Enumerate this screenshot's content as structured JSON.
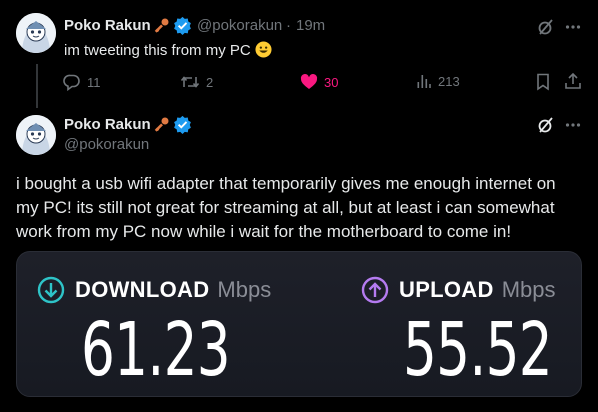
{
  "tweet1": {
    "name": "Poko Rakun",
    "handle": "@pokorakun",
    "separator": "·",
    "time": "19m",
    "text": "im tweeting this from my PC",
    "emoji": "grinning-face",
    "actions": {
      "replies": "11",
      "retweets": "2",
      "likes": "30",
      "views": "213"
    }
  },
  "tweet2": {
    "name": "Poko Rakun",
    "handle": "@pokorakun",
    "text": "i bought a usb wifi adapter that temporarily gives me enough internet on my PC! its still not great for streaming at all, but at least i can somewhat work from my PC now while i wait for the motherboard to come in!"
  },
  "speedtest": {
    "download_label": "DOWNLOAD",
    "download_unit": "Mbps",
    "download_value": "61.23",
    "upload_label": "UPLOAD",
    "upload_unit": "Mbps",
    "upload_value": "55.52"
  },
  "colors": {
    "like_active": "#f91880",
    "verified": "#1d9bf0",
    "download_accent": "#2ec4c8",
    "upload_accent": "#b57bf0"
  }
}
